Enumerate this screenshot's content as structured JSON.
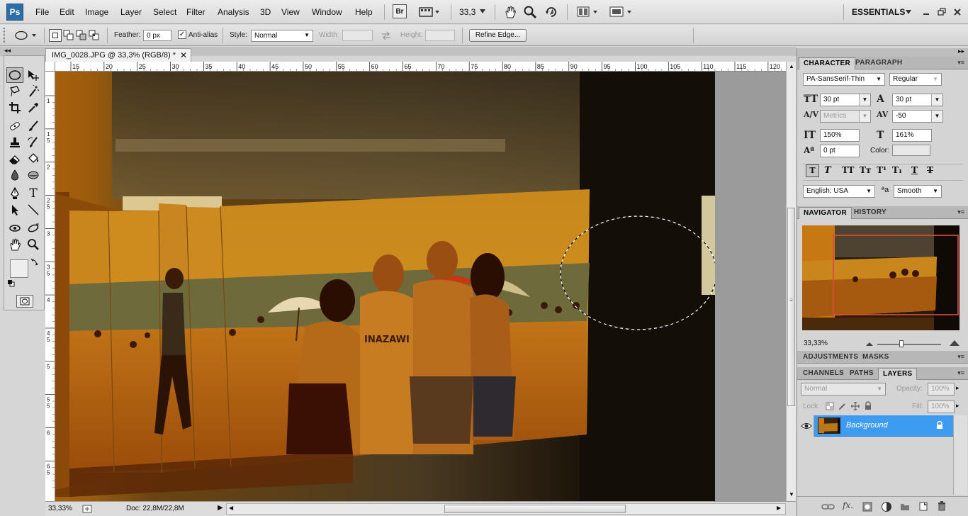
{
  "app": {
    "logo": "Ps",
    "workspace": "ESSENTIALS"
  },
  "menu": [
    "File",
    "Edit",
    "Image",
    "Layer",
    "Select",
    "Filter",
    "Analysis",
    "3D",
    "View",
    "Window",
    "Help"
  ],
  "appbar": {
    "bridge": "Br",
    "zoom": "33,3"
  },
  "options": {
    "feather_label": "Feather:",
    "feather_value": "0 px",
    "antialias_label": "Anti-alias",
    "antialias_checked": true,
    "style_label": "Style:",
    "style_value": "Normal",
    "width_label": "Width:",
    "height_label": "Height:",
    "refine_edge": "Refine Edge..."
  },
  "document": {
    "tab_title": "IMG_0028.JPG @ 33,3% (RGB/8) *",
    "ruler_h": [
      "15",
      "20",
      "25",
      "30",
      "35",
      "40",
      "45",
      "50",
      "55",
      "60",
      "65",
      "70",
      "75",
      "80",
      "85",
      "90",
      "95",
      "100",
      "105",
      "110",
      "115",
      "120"
    ],
    "ruler_v": [
      "1",
      "1\n5",
      "2",
      "2\n5",
      "3",
      "3\n5",
      "4",
      "4\n5",
      "5",
      "5\n5",
      "6",
      "6\n5"
    ]
  },
  "status": {
    "zoom": "33,33%",
    "doc": "Doc: 22,8M/22,8M"
  },
  "character": {
    "tabs": [
      "CHARACTER",
      "PARAGRAPH"
    ],
    "font_family": "PA-SansSerif-Thin",
    "font_style": "Regular",
    "size": "30 pt",
    "leading": "30 pt",
    "kerning": "Metrics",
    "tracking": "-50",
    "vscale": "150%",
    "hscale": "161%",
    "baseline": "0 pt",
    "color_label": "Color:",
    "language": "English: USA",
    "antialias": "Smooth"
  },
  "navigator": {
    "tabs": [
      "NAVIGATOR",
      "HISTORY"
    ],
    "zoom": "33,33%"
  },
  "adjust_tabs": [
    "ADJUSTMENTS",
    "MASKS"
  ],
  "layers": {
    "tabs": [
      "CHANNELS",
      "PATHS",
      "LAYERS"
    ],
    "blend_mode": "Normal",
    "opacity_label": "Opacity:",
    "opacity": "100%",
    "lock_label": "Lock:",
    "fill_label": "Fill:",
    "fill": "100%",
    "items": [
      {
        "name": "Background",
        "selected": true,
        "visible": true,
        "locked": true
      }
    ]
  },
  "colors": {
    "accent": "#3399ff",
    "selection_blue": "#3d9bf2"
  }
}
